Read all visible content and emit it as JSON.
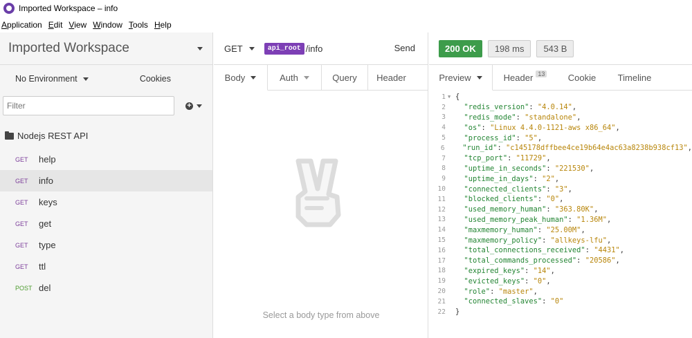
{
  "window": {
    "title": "Imported Workspace – info"
  },
  "menu": [
    {
      "u": "A",
      "rest": "pplication"
    },
    {
      "u": "E",
      "rest": "dit"
    },
    {
      "u": "V",
      "rest": "iew"
    },
    {
      "u": "W",
      "rest": "indow"
    },
    {
      "u": "T",
      "rest": "ools"
    },
    {
      "u": "H",
      "rest": "elp"
    }
  ],
  "sidebar": {
    "workspace": "Imported Workspace",
    "environment": "No Environment",
    "cookies": "Cookies",
    "filter_placeholder": "Filter",
    "folder": "Nodejs REST API",
    "requests": [
      {
        "method": "GET",
        "name": "help"
      },
      {
        "method": "GET",
        "name": "info"
      },
      {
        "method": "GET",
        "name": "keys"
      },
      {
        "method": "GET",
        "name": "get"
      },
      {
        "method": "GET",
        "name": "type"
      },
      {
        "method": "GET",
        "name": "ttl"
      },
      {
        "method": "POST",
        "name": "del"
      }
    ]
  },
  "request": {
    "method": "GET",
    "variable": "api_root",
    "path": "/info",
    "send": "Send",
    "tabs": [
      "Body",
      "Auth",
      "Query",
      "Header"
    ],
    "empty_hint": "Select a body type from above"
  },
  "response": {
    "status": "200 OK",
    "time": "198 ms",
    "size": "543 B",
    "tabs": {
      "preview": "Preview",
      "header": "Header",
      "header_count": "13",
      "cookie": "Cookie",
      "timeline": "Timeline"
    },
    "colors": {
      "status_ok": "#3d9c4b",
      "key": "#238533",
      "value": "#b8860b"
    },
    "body": [
      [
        "redis_version",
        "4.0.14"
      ],
      [
        "redis_mode",
        "standalone"
      ],
      [
        "os",
        "Linux 4.4.0-1121-aws x86_64"
      ],
      [
        "process_id",
        "5"
      ],
      [
        "run_id",
        "c145178dffbee4ce19b64e4ac63a8238b938cf13"
      ],
      [
        "tcp_port",
        "11729"
      ],
      [
        "uptime_in_seconds",
        "221530"
      ],
      [
        "uptime_in_days",
        "2"
      ],
      [
        "connected_clients",
        "3"
      ],
      [
        "blocked_clients",
        "0"
      ],
      [
        "used_memory_human",
        "363.80K"
      ],
      [
        "used_memory_peak_human",
        "1.36M"
      ],
      [
        "maxmemory_human",
        "25.00M"
      ],
      [
        "maxmemory_policy",
        "allkeys-lfu"
      ],
      [
        "total_connections_received",
        "4431"
      ],
      [
        "total_commands_processed",
        "20586"
      ],
      [
        "expired_keys",
        "14"
      ],
      [
        "evicted_keys",
        "0"
      ],
      [
        "role",
        "master"
      ],
      [
        "connected_slaves",
        "0"
      ]
    ]
  }
}
